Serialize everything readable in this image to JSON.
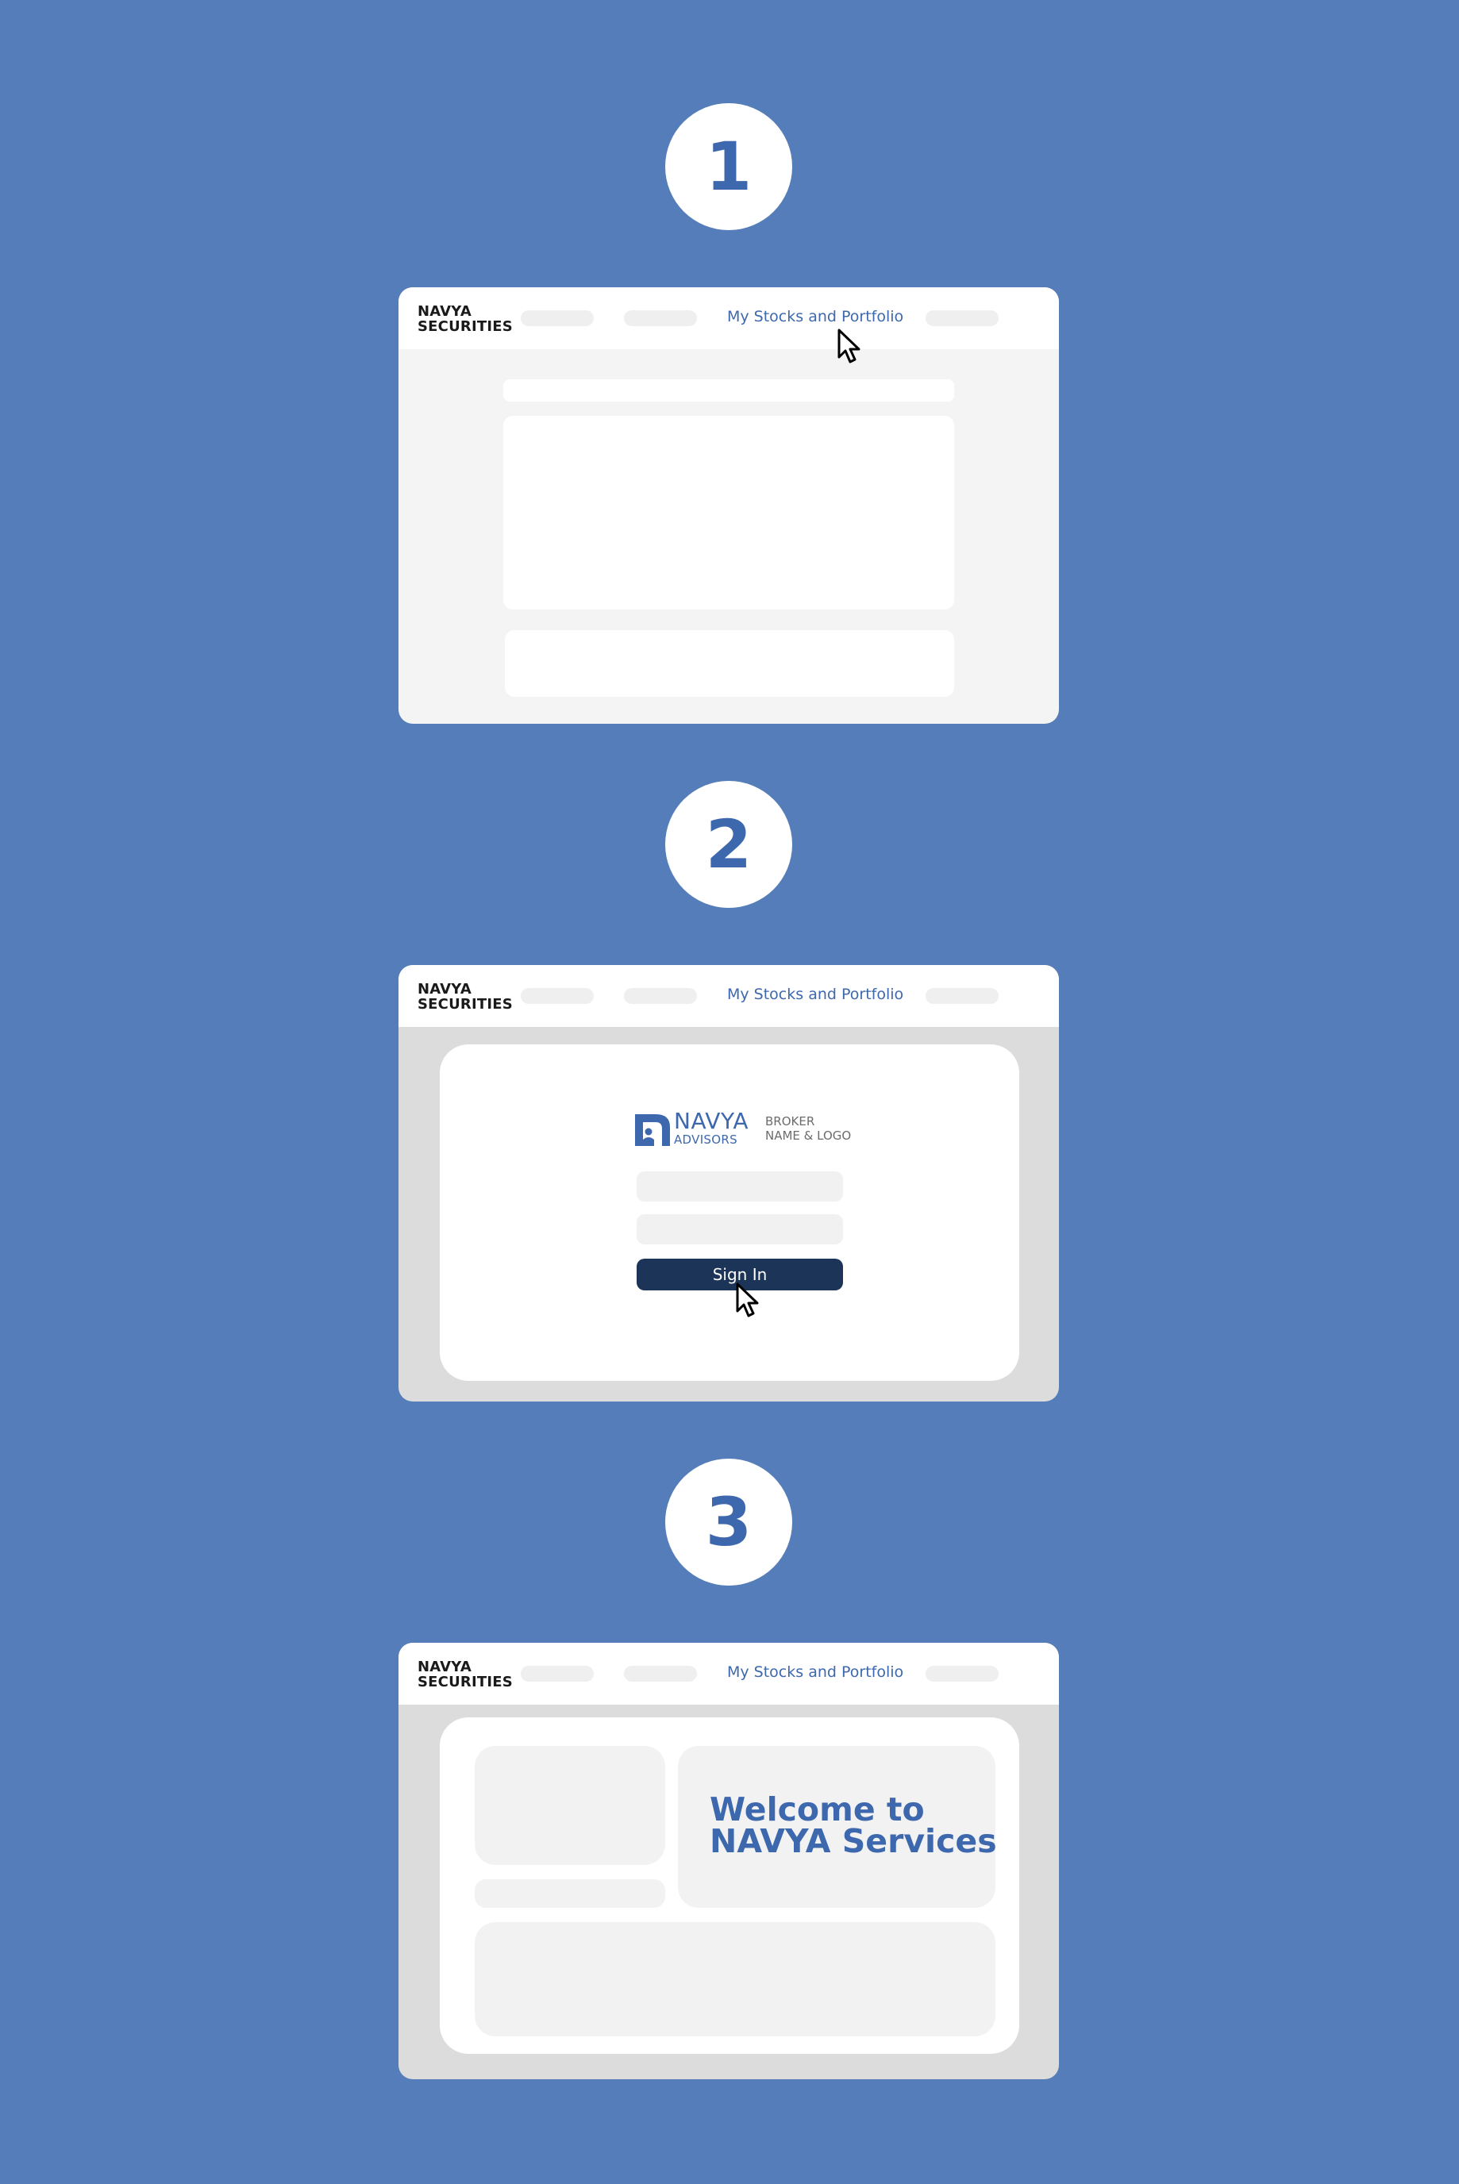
{
  "colors": {
    "background": "#547db9",
    "accent": "#3e68ad",
    "button": "#1c3457"
  },
  "steps": [
    {
      "number": "1"
    },
    {
      "number": "2"
    },
    {
      "number": "3"
    }
  ],
  "navbar": {
    "brand_line1": "NAVYA",
    "brand_line2": "SECURITIES",
    "active_link": "My Stocks and Portfolio"
  },
  "login": {
    "logo_word": "NAVYA",
    "logo_sub": "ADVISORS",
    "broker_line1": "BROKER",
    "broker_line2": "NAME & LOGO",
    "signin_label": "Sign In"
  },
  "dashboard": {
    "welcome_line1": "Welcome to",
    "welcome_line2": "NAVYA Services"
  },
  "icons": [
    "cursor-arrow-icon",
    "navya-logo-icon"
  ]
}
